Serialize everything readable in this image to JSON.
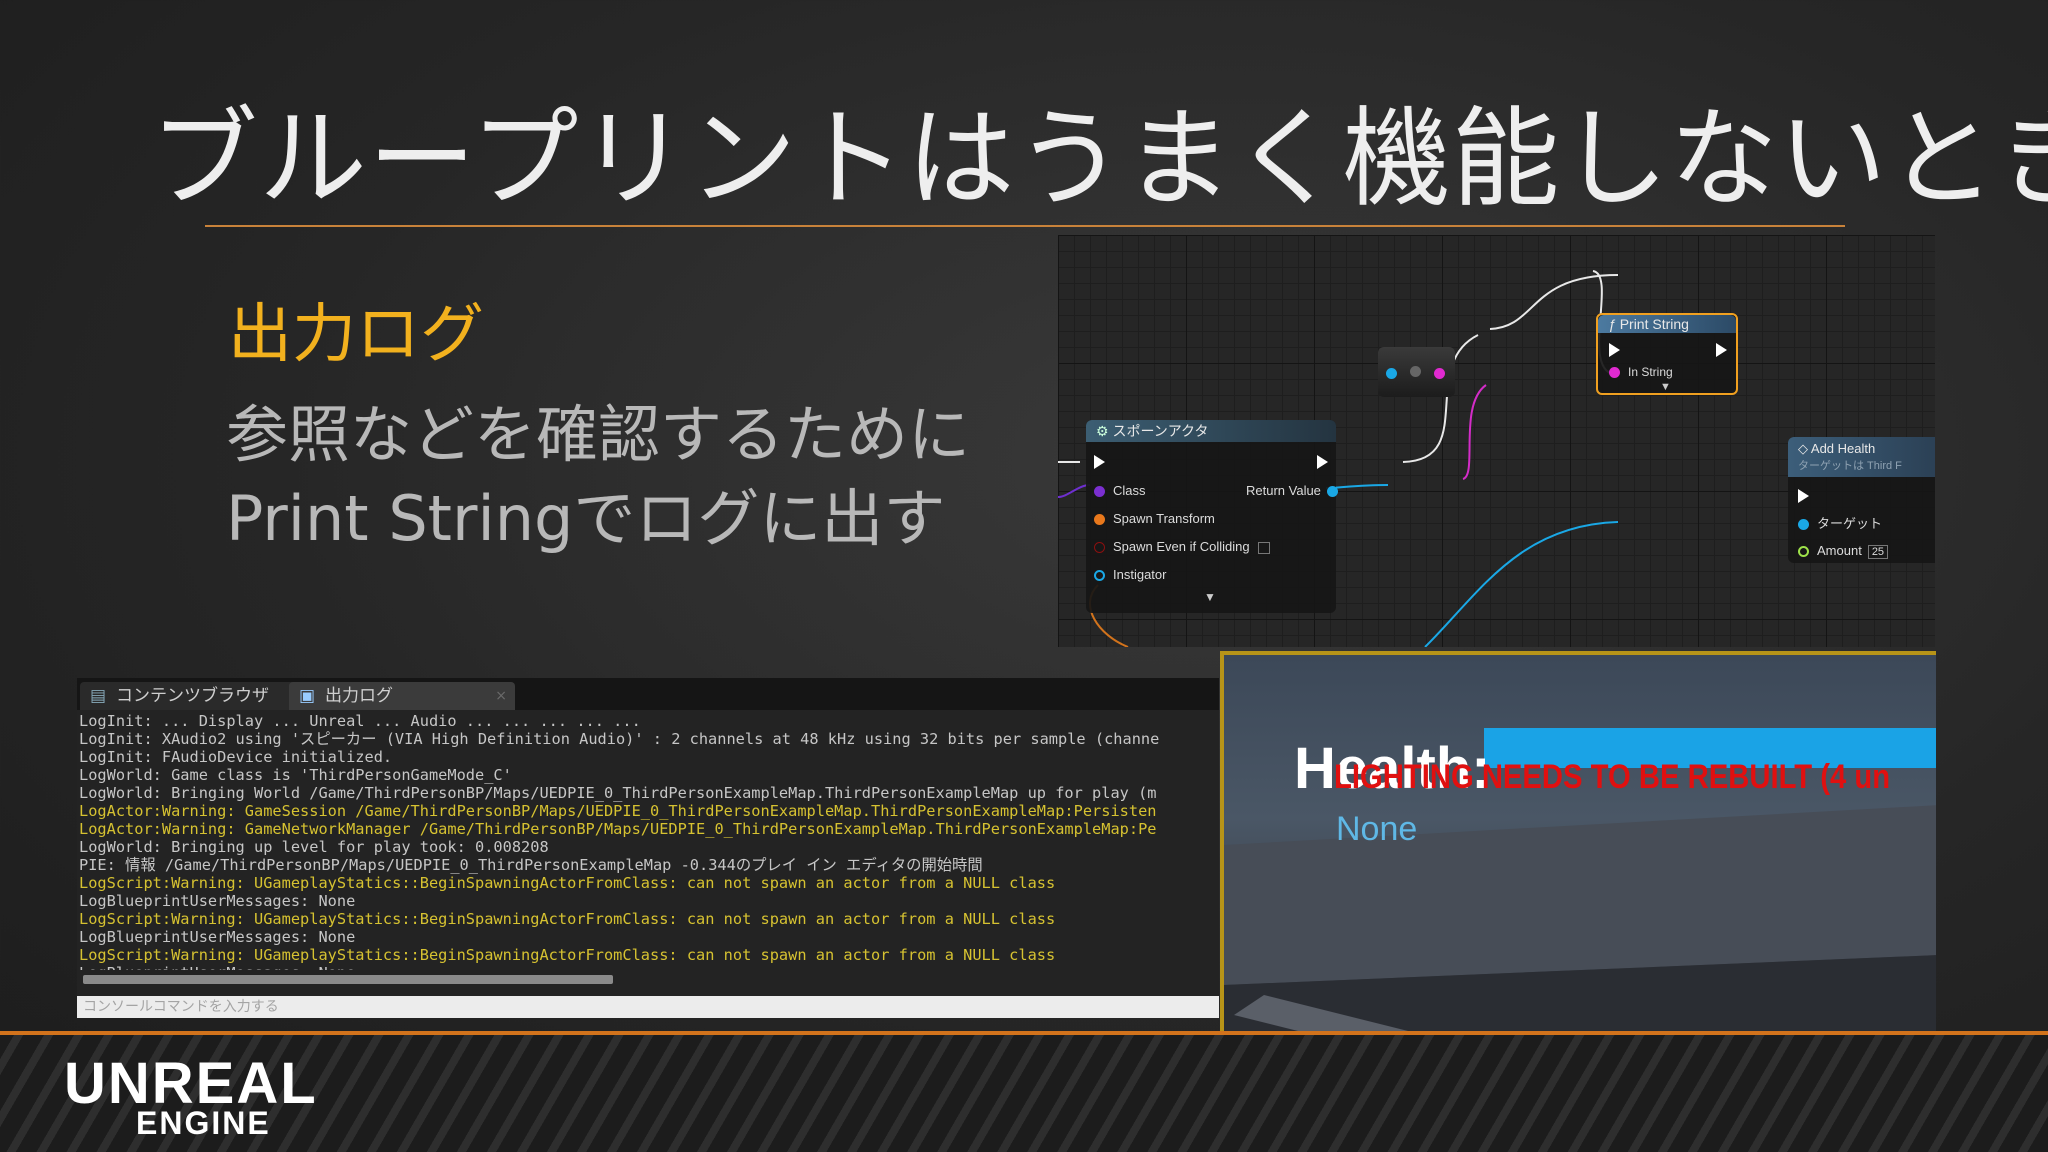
{
  "slide": {
    "title": "ブループリントはうまく機能しないとき",
    "sub_heading": "出力ログ",
    "body_lines": [
      "参照などを確認するために",
      "Print Stringでログに出す"
    ]
  },
  "blueprint": {
    "spawn_node": {
      "title": "スポーンアクタ",
      "pins_in": [
        "Class",
        "Spawn Transform",
        "Spawn Even if Colliding",
        "Instigator"
      ],
      "pin_out": "Return Value"
    },
    "print_string_node": {
      "title": "Print String",
      "pin_in": "In String"
    },
    "add_health_node": {
      "title": "Add Health",
      "subtitle": "ターゲットは Third F",
      "pin_target": "ターゲット",
      "pin_amount": "Amount",
      "amount_value": "25"
    }
  },
  "output_log": {
    "tabs": [
      {
        "label": "コンテンツブラウザ",
        "icon": "content-browser-icon"
      },
      {
        "label": "出力ログ",
        "icon": "output-log-icon"
      }
    ],
    "lines": [
      {
        "text": "LogInit: ... Display ... Unreal ... Audio ... ... ... ... ...",
        "level": "normal"
      },
      {
        "text": "LogInit: XAudio2 using 'スピーカー (VIA High Definition Audio)' : 2 channels at 48 kHz using 32 bits per sample (channe",
        "level": "normal"
      },
      {
        "text": "LogInit: FAudioDevice initialized.",
        "level": "normal"
      },
      {
        "text": "LogWorld: Game class is 'ThirdPersonGameMode_C'",
        "level": "normal"
      },
      {
        "text": "LogWorld: Bringing World /Game/ThirdPersonBP/Maps/UEDPIE_0_ThirdPersonExampleMap.ThirdPersonExampleMap up for play (m",
        "level": "normal"
      },
      {
        "text": "LogActor:Warning: GameSession /Game/ThirdPersonBP/Maps/UEDPIE_0_ThirdPersonExampleMap.ThirdPersonExampleMap:Persisten",
        "level": "warning"
      },
      {
        "text": "LogActor:Warning: GameNetworkManager /Game/ThirdPersonBP/Maps/UEDPIE_0_ThirdPersonExampleMap.ThirdPersonExampleMap:Pe",
        "level": "warning"
      },
      {
        "text": "LogWorld: Bringing up level for play took: 0.008208",
        "level": "normal"
      },
      {
        "text": "PIE: 情報 /Game/ThirdPersonBP/Maps/UEDPIE_0_ThirdPersonExampleMap -0.344のプレイ イン エディタの開始時間",
        "level": "normal"
      },
      {
        "text": "LogScript:Warning: UGameplayStatics::BeginSpawningActorFromClass: can not spawn an actor from a NULL class",
        "level": "warning"
      },
      {
        "text": "LogBlueprintUserMessages: None",
        "level": "normal"
      },
      {
        "text": "LogScript:Warning: UGameplayStatics::BeginSpawningActorFromClass: can not spawn an actor from a NULL class",
        "level": "warning"
      },
      {
        "text": "LogBlueprintUserMessages: None",
        "level": "normal"
      },
      {
        "text": "LogScript:Warning: UGameplayStatics::BeginSpawningActorFromClass: can not spawn an actor from a NULL class",
        "level": "warning"
      },
      {
        "text": "LogBlueprintUserMessages: None",
        "level": "normal"
      }
    ],
    "console_placeholder": "コンソールコマンドを入力する"
  },
  "viewport": {
    "health_label": "Health:",
    "warning_text": "LIGHTING NEEDS TO BE REBUILT (4 un",
    "value_text": "None"
  },
  "footer": {
    "logo_top": "UNREAL",
    "logo_bottom": "ENGINE"
  }
}
